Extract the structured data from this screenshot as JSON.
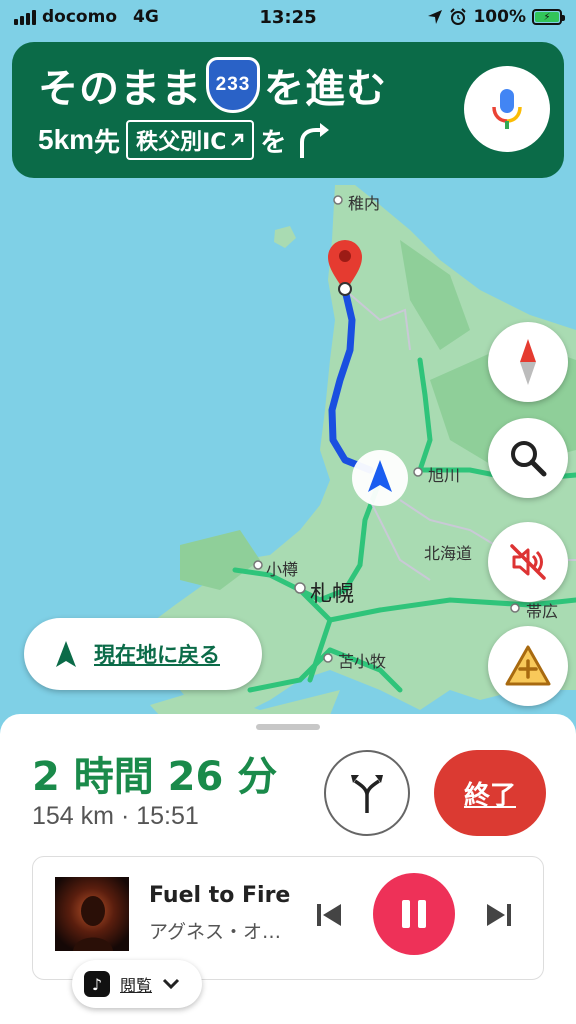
{
  "status_bar": {
    "carrier": "docomo",
    "network": "4G",
    "time": "13:25",
    "battery": "100%"
  },
  "nav_banner": {
    "instruction_before": "そのまま",
    "route_number": "233",
    "instruction_after": "を進む",
    "distance": "5km",
    "distance_suffix": "先",
    "exit_name": "秩父別IC",
    "exit_suffix": "を",
    "mic_icon": "microphone-icon",
    "turn_icon": "turn-right-arrow-icon"
  },
  "map_labels": {
    "wakkanai": "稚内",
    "asahikawa": "旭川",
    "hokkaido": "北海道",
    "otaru": "小樽",
    "sapporo": "札幌",
    "obihiro": "帯広",
    "tomakomai": "苫小牧"
  },
  "map_buttons": {
    "compass_icon": "compass-icon",
    "search_icon": "search-icon",
    "mute_icon": "sound-off-icon",
    "report_icon": "report-incident-icon",
    "recenter_label": "現在地に戻る"
  },
  "trip": {
    "duration": "2 時間 26 分",
    "distance": "154 km",
    "separator": "·",
    "arrival": "15:51",
    "end_label": "終了"
  },
  "media": {
    "title": "Fuel to Fire",
    "artist": "アグネス・オ…",
    "source_label": "閲覧"
  },
  "colors": {
    "banner": "#0b6b48",
    "eta": "#1a8a4a",
    "end": "#db3a32",
    "pause": "#ee3158",
    "route": "#1a4fe0"
  }
}
